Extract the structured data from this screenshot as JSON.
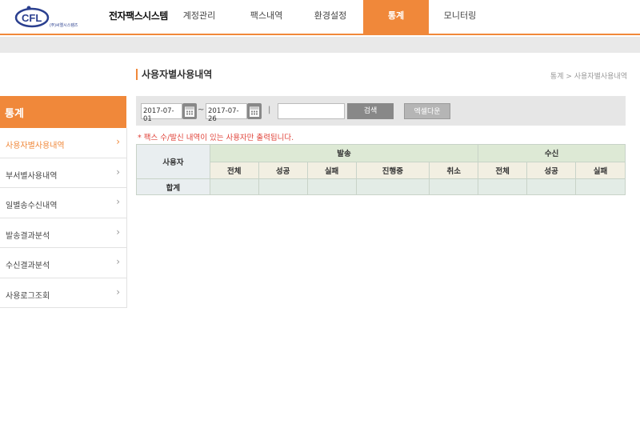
{
  "header": {
    "logo_text": "CFL",
    "logo_company": "(주)씨엘시스템즈",
    "system_title": "전자팩스시스템",
    "nav": [
      {
        "label": "계정관리",
        "active": false
      },
      {
        "label": "팩스내역",
        "active": false
      },
      {
        "label": "환경설정",
        "active": false
      },
      {
        "label": "통계",
        "active": true
      },
      {
        "label": "모니터링",
        "active": false
      }
    ]
  },
  "sidebar": {
    "title": "통계",
    "items": [
      {
        "label": "사용자별사용내역",
        "active": true
      },
      {
        "label": "부서별사용내역",
        "active": false
      },
      {
        "label": "일별송수신내역",
        "active": false
      },
      {
        "label": "발송결과분석",
        "active": false
      },
      {
        "label": "수신결과분석",
        "active": false
      },
      {
        "label": "사용로그조회",
        "active": false
      }
    ]
  },
  "page": {
    "title": "사용자별사용내역",
    "breadcrumb": "통계 > 사용자별사용내역"
  },
  "search": {
    "start_date": "2017-07-01",
    "end_date": "2017-07-26",
    "tilde": "~",
    "separator": "|",
    "keyword_value": "",
    "search_label": "검색",
    "excel_label": "엑셀다운"
  },
  "notice": "* 팩스 수/발신 내역이 있는 사용자만 출력됩니다.",
  "table": {
    "user_header": "사용자",
    "send_header": "발송",
    "recv_header": "수신",
    "send_cols": [
      "전체",
      "성공",
      "실패",
      "진행중",
      "취소"
    ],
    "recv_cols": [
      "전체",
      "성공",
      "실패"
    ],
    "total_label": "합계"
  },
  "colors": {
    "accent": "#f0883a",
    "notice": "#e0433a"
  }
}
